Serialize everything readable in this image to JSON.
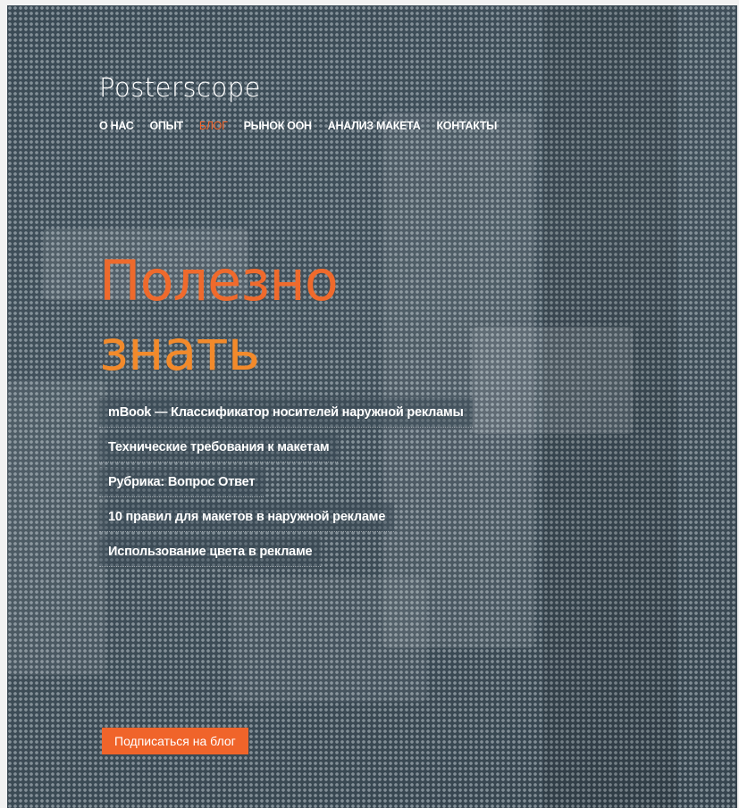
{
  "brand": {
    "name": "Posterscope"
  },
  "nav": {
    "items": [
      {
        "label": "О НАС"
      },
      {
        "label": "ОПЫТ"
      },
      {
        "label": "БЛОГ",
        "active": true
      },
      {
        "label": "РЫНОК ООН"
      },
      {
        "label": "АНАЛИЗ МАКЕТА"
      },
      {
        "label": "КОНТАКТЫ"
      }
    ]
  },
  "hero": {
    "line1": "Полезно",
    "line2": "знать"
  },
  "posts": [
    {
      "title": "mBook — Классификатор носителей наружной рекламы"
    },
    {
      "title": "Технические требования к макетам"
    },
    {
      "title": "Рубрика: Вопрос Ответ"
    },
    {
      "title": "10 правил для макетов в наружной рекламе"
    },
    {
      "title": "Использование цвета в рекламе"
    }
  ],
  "subscribe": {
    "label": "Подписаться на блог"
  },
  "colors": {
    "accent": "#f0642a",
    "accent_light": "#f28a2b",
    "background": "#3a4a55",
    "text": "#ffffff"
  }
}
